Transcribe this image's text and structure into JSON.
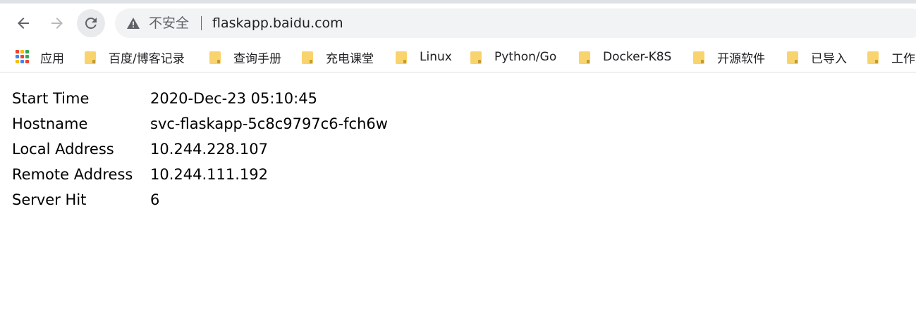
{
  "browser": {
    "security_label": "不安全",
    "url": "flaskapp.baidu.com"
  },
  "bookmarks": [
    {
      "label": "应用",
      "icon": "apps-grid-icon"
    },
    {
      "label": "百度/博客记录",
      "icon": "folder-icon"
    },
    {
      "label": "查询手册",
      "icon": "folder-icon"
    },
    {
      "label": "充电课堂",
      "icon": "folder-icon"
    },
    {
      "label": "Linux",
      "icon": "folder-icon"
    },
    {
      "label": "Python/Go",
      "icon": "folder-icon"
    },
    {
      "label": "Docker-K8S",
      "icon": "folder-icon"
    },
    {
      "label": "开源软件",
      "icon": "folder-icon"
    },
    {
      "label": "已导入",
      "icon": "folder-icon"
    },
    {
      "label": "工作",
      "icon": "folder-icon"
    }
  ],
  "info_rows": [
    {
      "key": "Start Time",
      "value": "2020-Dec-23 05:10:45"
    },
    {
      "key": "Hostname",
      "value": "svc-flaskapp-5c8c9797c6-fch6w"
    },
    {
      "key": "Local Address",
      "value": "10.244.228.107"
    },
    {
      "key": "Remote Address",
      "value": "10.244.111.192"
    },
    {
      "key": "Server Hit",
      "value": "6"
    }
  ],
  "colors": {
    "folder": "#f9d36d",
    "apps_grid": [
      "#ea4335",
      "#fbbc05",
      "#34a853",
      "#4285f4",
      "#ea4335",
      "#34a853",
      "#fbbc05",
      "#4285f4",
      "#ea4335"
    ]
  }
}
